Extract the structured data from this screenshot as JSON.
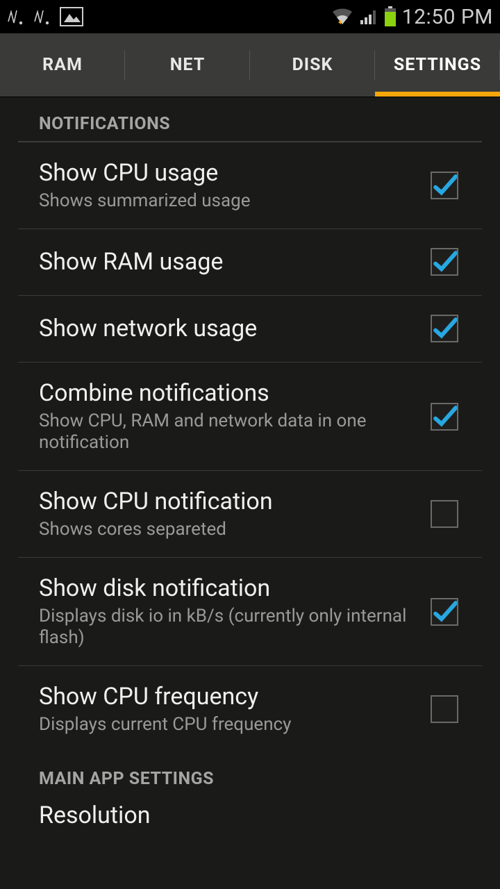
{
  "status": {
    "time": "12:50 PM"
  },
  "tabs": [
    {
      "label": "RAM"
    },
    {
      "label": "NET"
    },
    {
      "label": "DISK"
    },
    {
      "label": "SETTINGS"
    }
  ],
  "active_tab_index": 3,
  "sections": {
    "notifications": {
      "header": "NOTIFICATIONS",
      "items": [
        {
          "title": "Show CPU usage",
          "subtitle": "Shows summarized usage",
          "checked": true
        },
        {
          "title": "Show RAM usage",
          "subtitle": "",
          "checked": true
        },
        {
          "title": "Show network usage",
          "subtitle": "",
          "checked": true
        },
        {
          "title": "Combine notifications",
          "subtitle": "Show CPU, RAM and network data in one notification",
          "checked": true
        },
        {
          "title": "Show CPU notification",
          "subtitle": "Shows cores separeted",
          "checked": false
        },
        {
          "title": "Show disk notification",
          "subtitle": "Displays disk io in kB/s (currently only internal flash)",
          "checked": true
        },
        {
          "title": "Show CPU frequency",
          "subtitle": "Displays current CPU frequency",
          "checked": false
        }
      ]
    },
    "main_app": {
      "header": "MAIN APP SETTINGS",
      "items": [
        {
          "title": "Resolution"
        }
      ]
    }
  },
  "colors": {
    "accent": "#f7a60a",
    "check": "#28a7e1"
  }
}
